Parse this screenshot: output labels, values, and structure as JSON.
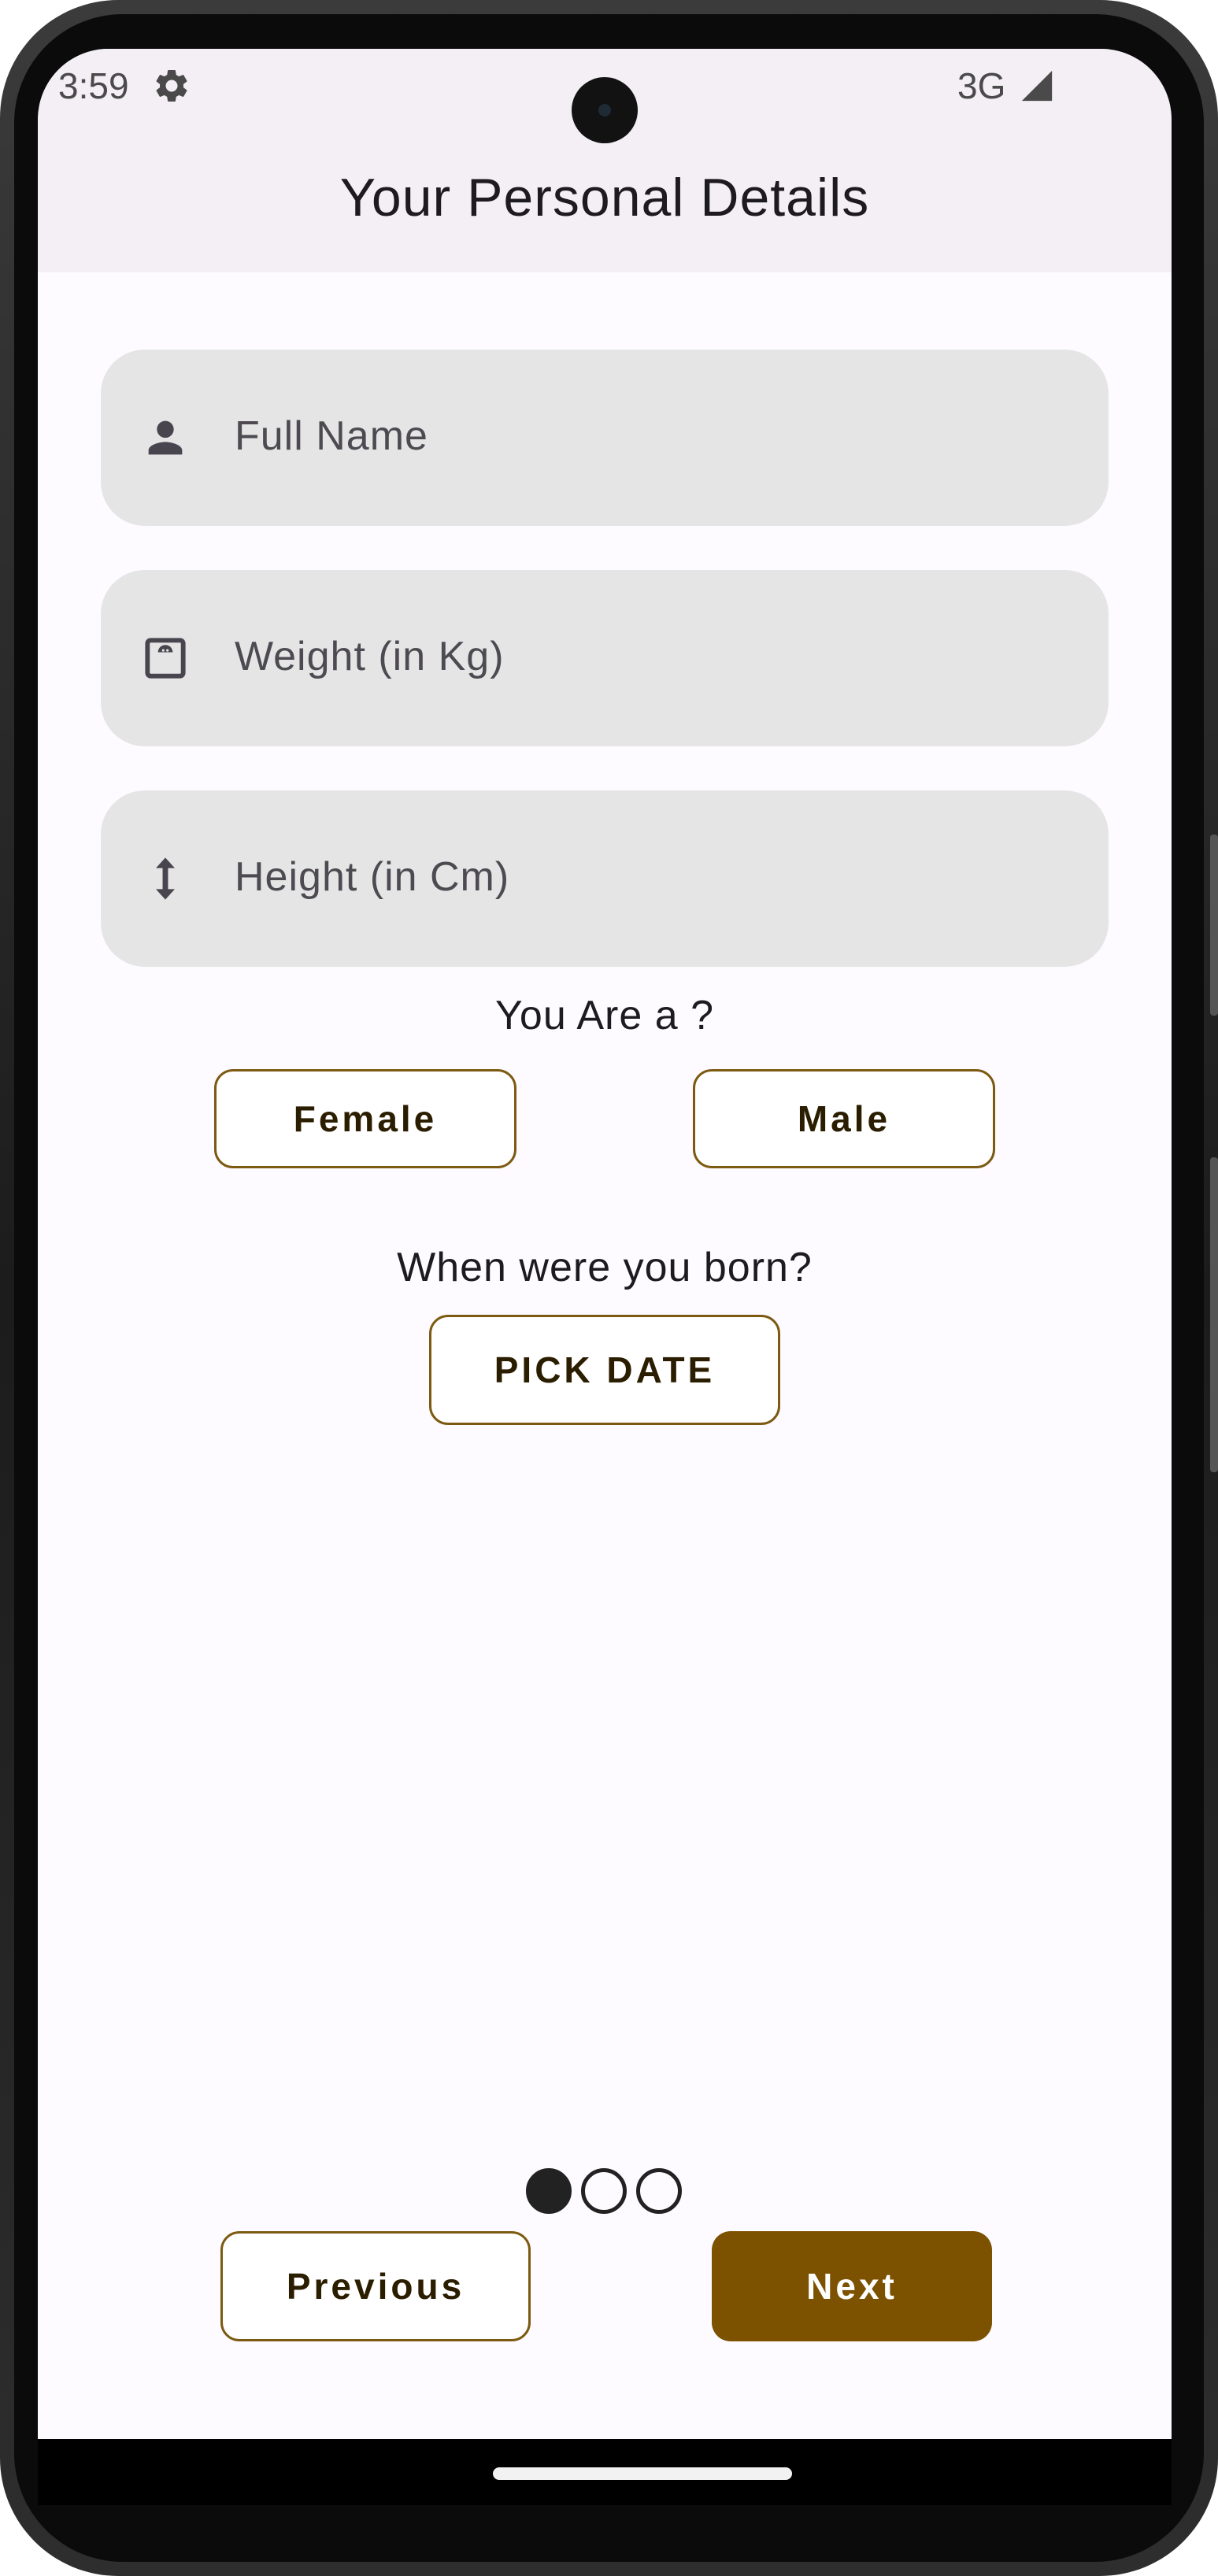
{
  "status_bar": {
    "time": "3:59",
    "network": "3G",
    "icons": [
      "gear-icon",
      "signal-icon"
    ]
  },
  "header": {
    "title": "Your Personal Details"
  },
  "form": {
    "full_name": {
      "placeholder": "Full Name",
      "icon": "person-icon"
    },
    "weight": {
      "placeholder": "Weight (in Kg)",
      "icon": "scale-icon"
    },
    "height": {
      "placeholder": "Height (in Cm)",
      "icon": "vertical-arrows-icon"
    }
  },
  "gender": {
    "question": "You Are a ?",
    "options": [
      "Female",
      "Male"
    ]
  },
  "birth": {
    "question": "When were you born?",
    "button_label": "PICK DATE"
  },
  "pager": {
    "total_pages": 3,
    "current_page": 1
  },
  "navigation": {
    "previous_label": "Previous",
    "next_label": "Next"
  },
  "colors": {
    "accent": "#7c5100",
    "outline": "#7c5a12",
    "field_bg": "#e5e5e5",
    "appbar_bg": "#f3eff5",
    "screen_bg": "#fdfbff"
  }
}
